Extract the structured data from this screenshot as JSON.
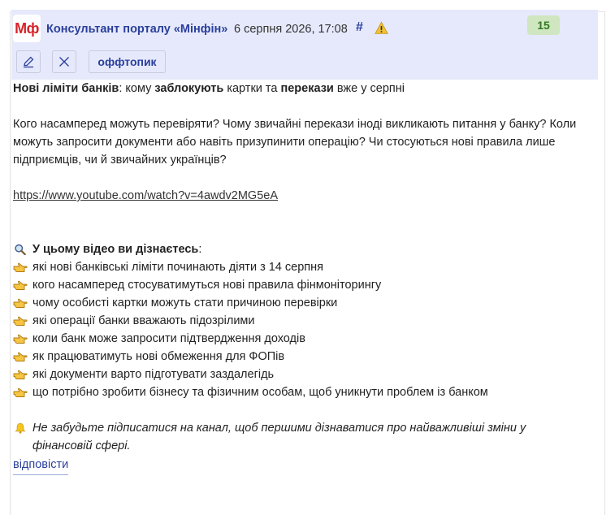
{
  "header": {
    "logo_text": "Мф",
    "author": "Консультант порталу «Мінфін»",
    "datetime": "6 серпня 2026, 17:08",
    "hash": "#",
    "score": "15"
  },
  "toolbar": {
    "offtopic_label": "оффтопик"
  },
  "post": {
    "headline": {
      "part1": "Нові ліміти банків",
      "part2": ": кому ",
      "part3": "заблокують",
      "part4": " картки та ",
      "part5": "перекази",
      "part6": " вже у серпні"
    },
    "intro": "Кого насамперед можуть перевіряти? Чому звичайні перекази іноді викликають питання у банку? Коли можуть запросити документи або навіть призупинити операцію? Чи стосуються нові правила лише підприємців, чи й звичайних українців?",
    "video_link": "https://www.youtube.com/watch?v=4awdv2MG5eA",
    "learn_title": "У цьому відео ви дізнаєтесь",
    "learn_colon": ":",
    "items": [
      "які нові банківські ліміти починають діяти з 14 серпня",
      "кого насамперед стосуватимуться нові правила фінмоніторингу",
      "чому особисті картки можуть стати причиною перевірки",
      "які операції банки вважають підозрілими",
      "коли банк може запросити підтвердження доходів",
      "як працюватимуть нові обмеження для ФОПів",
      "які документи варто підготувати заздалегідь",
      "що потрібно зробити бізнесу та фізичним особам, щоб уникнути проблем із банком"
    ],
    "footer_note": "Не забудьте підписатися на канал, щоб першими дізнаватися про найважливіші зміни у фінансовій сфері."
  },
  "actions": {
    "reply_label": "відповісти"
  },
  "colors": {
    "header_bg": "#e6e9fb",
    "accent": "#2a3f9c",
    "logo_red": "#d8232a",
    "score_bg": "#cfe6c0",
    "score_text": "#2f7a1f"
  },
  "icons": {
    "edit": "pencil-icon",
    "close": "close-icon",
    "warning": "warning-icon",
    "search": "magnifier-icon",
    "bullet": "pointing-hand-icon",
    "bell": "bell-icon"
  }
}
